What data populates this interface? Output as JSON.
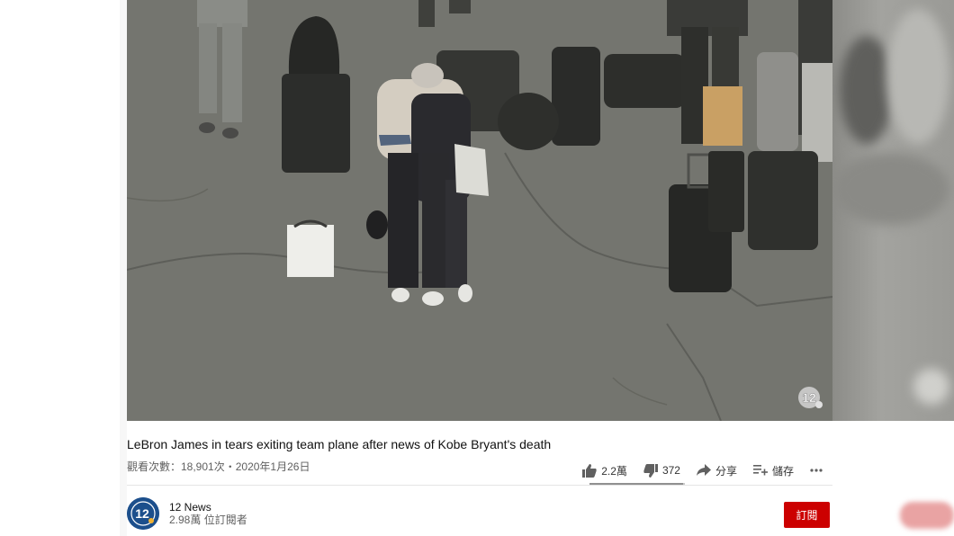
{
  "video": {
    "title": "LeBron James in tears exiting team plane after news of Kobe Bryant's death",
    "views": "觀看次數：18,901次",
    "separator": "・",
    "date": "2020年1月26日"
  },
  "actions": {
    "likes": "2.2萬",
    "dislikes": "372",
    "share_label": "分享",
    "save_label": "儲存",
    "like_ratio": 0.98
  },
  "channel": {
    "name": "12 News",
    "subscribers": "2.98萬 位訂閱者",
    "avatar_text": "12"
  },
  "subscribe": {
    "label": "訂閱"
  },
  "colors": {
    "subscribe_red": "#cc0000",
    "avatar_blue": "#1c4f8c",
    "tarmac": "#74756f"
  },
  "icons": [
    "thumb-up-icon",
    "thumb-down-icon",
    "share-icon",
    "save-playlist-icon",
    "more-icon",
    "channel-logo-icon"
  ]
}
